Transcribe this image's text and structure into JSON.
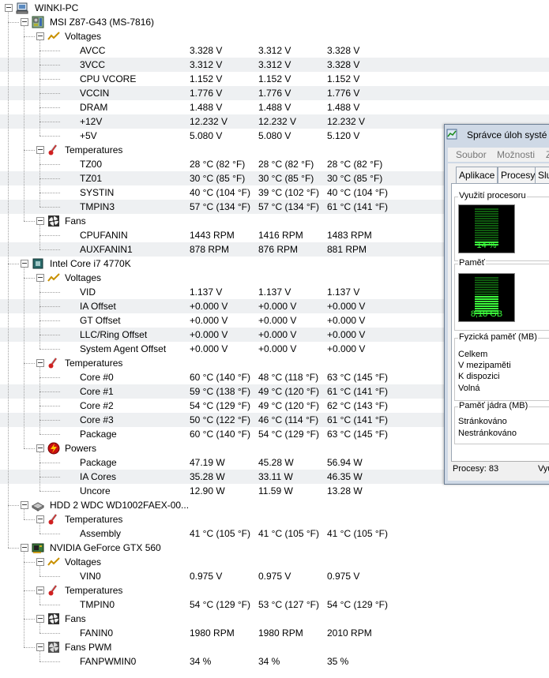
{
  "tree": [
    {
      "level": 0,
      "icon": "computer-icon",
      "label": "WINKI-PC"
    },
    {
      "level": 1,
      "icon": "motherboard-icon",
      "label": "MSI Z87-G43 (MS-7816)"
    },
    {
      "level": 2,
      "icon": "voltage-icon",
      "label": "Voltages"
    },
    {
      "level": 3,
      "label": "AVCC",
      "values": [
        "3.328 V",
        "3.312 V",
        "3.328 V"
      ]
    },
    {
      "level": 3,
      "label": "3VCC",
      "values": [
        "3.312 V",
        "3.312 V",
        "3.328 V"
      ]
    },
    {
      "level": 3,
      "label": "CPU VCORE",
      "values": [
        "1.152 V",
        "1.152 V",
        "1.152 V"
      ]
    },
    {
      "level": 3,
      "label": "VCCIN",
      "values": [
        "1.776 V",
        "1.776 V",
        "1.776 V"
      ]
    },
    {
      "level": 3,
      "label": "DRAM",
      "values": [
        "1.488 V",
        "1.488 V",
        "1.488 V"
      ]
    },
    {
      "level": 3,
      "label": "+12V",
      "values": [
        "12.232 V",
        "12.232 V",
        "12.232 V"
      ]
    },
    {
      "level": 3,
      "label": "+5V",
      "values": [
        "5.080 V",
        "5.080 V",
        "5.120 V"
      ]
    },
    {
      "level": 2,
      "icon": "thermometer-icon",
      "label": "Temperatures"
    },
    {
      "level": 3,
      "label": "TZ00",
      "values": [
        "28 °C  (82 °F)",
        "28 °C  (82 °F)",
        "28 °C  (82 °F)"
      ]
    },
    {
      "level": 3,
      "label": "TZ01",
      "values": [
        "30 °C  (85 °F)",
        "30 °C  (85 °F)",
        "30 °C  (85 °F)"
      ]
    },
    {
      "level": 3,
      "label": "SYSTIN",
      "values": [
        "40 °C  (104 °F)",
        "39 °C  (102 °F)",
        "40 °C  (104 °F)"
      ]
    },
    {
      "level": 3,
      "label": "TMPIN3",
      "values": [
        "57 °C  (134 °F)",
        "57 °C  (134 °F)",
        "61 °C  (141 °F)"
      ]
    },
    {
      "level": 2,
      "icon": "fan-icon",
      "label": "Fans"
    },
    {
      "level": 3,
      "label": "CPUFANIN",
      "values": [
        "1443 RPM",
        "1416 RPM",
        "1483 RPM"
      ]
    },
    {
      "level": 3,
      "label": "AUXFANIN1",
      "values": [
        "878 RPM",
        "876 RPM",
        "881 RPM"
      ]
    },
    {
      "level": 1,
      "icon": "cpu-icon",
      "label": "Intel Core i7 4770K"
    },
    {
      "level": 2,
      "icon": "voltage-icon",
      "label": "Voltages"
    },
    {
      "level": 3,
      "label": "VID",
      "values": [
        "1.137 V",
        "1.137 V",
        "1.137 V"
      ]
    },
    {
      "level": 3,
      "label": "IA Offset",
      "values": [
        "+0.000 V",
        "+0.000 V",
        "+0.000 V"
      ]
    },
    {
      "level": 3,
      "label": "GT Offset",
      "values": [
        "+0.000 V",
        "+0.000 V",
        "+0.000 V"
      ]
    },
    {
      "level": 3,
      "label": "LLC/Ring Offset",
      "values": [
        "+0.000 V",
        "+0.000 V",
        "+0.000 V"
      ]
    },
    {
      "level": 3,
      "label": "System Agent Offset",
      "values": [
        "+0.000 V",
        "+0.000 V",
        "+0.000 V"
      ]
    },
    {
      "level": 2,
      "icon": "thermometer-icon",
      "label": "Temperatures"
    },
    {
      "level": 3,
      "label": "Core #0",
      "values": [
        "60 °C  (140 °F)",
        "48 °C  (118 °F)",
        "63 °C  (145 °F)"
      ]
    },
    {
      "level": 3,
      "label": "Core #1",
      "values": [
        "59 °C  (138 °F)",
        "49 °C  (120 °F)",
        "61 °C  (141 °F)"
      ]
    },
    {
      "level": 3,
      "label": "Core #2",
      "values": [
        "54 °C  (129 °F)",
        "49 °C  (120 °F)",
        "62 °C  (143 °F)"
      ]
    },
    {
      "level": 3,
      "label": "Core #3",
      "values": [
        "50 °C  (122 °F)",
        "46 °C  (114 °F)",
        "61 °C  (141 °F)"
      ]
    },
    {
      "level": 3,
      "label": "Package",
      "values": [
        "60 °C  (140 °F)",
        "54 °C  (129 °F)",
        "63 °C  (145 °F)"
      ]
    },
    {
      "level": 2,
      "icon": "power-icon",
      "label": "Powers"
    },
    {
      "level": 3,
      "label": "Package",
      "values": [
        "47.19 W",
        "45.28 W",
        "56.94 W"
      ]
    },
    {
      "level": 3,
      "label": "IA Cores",
      "values": [
        "35.28 W",
        "33.11 W",
        "46.35 W"
      ]
    },
    {
      "level": 3,
      "label": "Uncore",
      "values": [
        "12.90 W",
        "11.59 W",
        "13.28 W"
      ]
    },
    {
      "level": 1,
      "icon": "hdd-icon",
      "label": "HDD 2 WDC WD1002FAEX-00..."
    },
    {
      "level": 2,
      "icon": "thermometer-icon",
      "label": "Temperatures"
    },
    {
      "level": 3,
      "label": "Assembly",
      "values": [
        "41 °C  (105 °F)",
        "41 °C  (105 °F)",
        "41 °C  (105 °F)"
      ]
    },
    {
      "level": 1,
      "icon": "gpu-icon",
      "label": "NVIDIA GeForce GTX 560"
    },
    {
      "level": 2,
      "icon": "voltage-icon",
      "label": "Voltages"
    },
    {
      "level": 3,
      "label": "VIN0",
      "values": [
        "0.975 V",
        "0.975 V",
        "0.975 V"
      ]
    },
    {
      "level": 2,
      "icon": "thermometer-icon",
      "label": "Temperatures"
    },
    {
      "level": 3,
      "label": "TMPIN0",
      "values": [
        "54 °C  (129 °F)",
        "53 °C  (127 °F)",
        "54 °C  (129 °F)"
      ]
    },
    {
      "level": 2,
      "icon": "fan-icon",
      "label": "Fans"
    },
    {
      "level": 3,
      "label": "FANIN0",
      "values": [
        "1980 RPM",
        "1980 RPM",
        "2010 RPM"
      ]
    },
    {
      "level": 2,
      "icon": "fan-pwm-icon",
      "label": "Fans PWM"
    },
    {
      "level": 3,
      "label": "FANPWMIN0",
      "values": [
        "34 %",
        "34 %",
        "35 %"
      ]
    }
  ],
  "task_manager": {
    "title": "Správce úloh systé",
    "menu": [
      "Soubor",
      "Možnosti",
      "Z"
    ],
    "tabs": [
      "Aplikace",
      "Procesy",
      "Slu"
    ],
    "cpu_group": "Využití procesoru",
    "cpu_value": "14 %",
    "cpu_fraction": 0.14,
    "mem_group": "Paměť",
    "mem_value": "8,18 GB",
    "phys_group": "Fyzická paměť (MB)",
    "phys_items": [
      "Celkem",
      "V mezipaměti",
      "K dispozici",
      "Volná"
    ],
    "kernel_group": "Paměť jádra (MB)",
    "kernel_items": [
      "Stránkováno",
      "Nestránkováno"
    ],
    "status_processes": "Procesy: 83",
    "status_right": "Vyu"
  },
  "colors": {
    "alt_row": "#eef0f2",
    "meter_green": "#3cff3c",
    "window_frame": "#cfd9e6"
  }
}
